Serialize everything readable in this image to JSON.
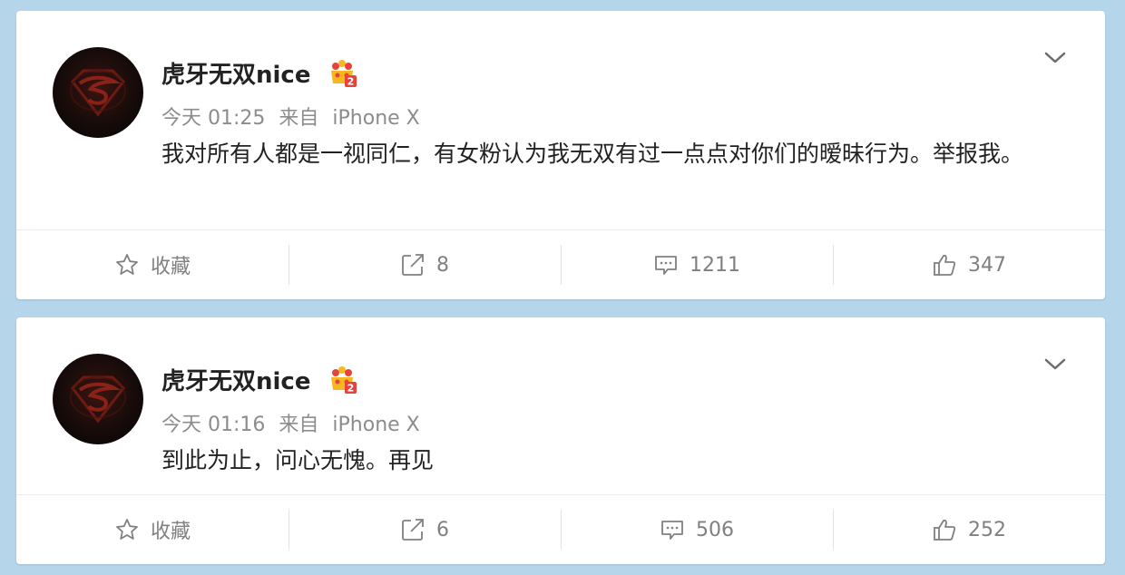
{
  "posts": [
    {
      "username": "虎牙无双nice",
      "time": "今天 01:25",
      "source_prefix": "来自",
      "source_device": "iPhone X",
      "content": "我对所有人都是一视同仁，有女粉认为我无双有过一点点对你们的暧昧行为。举报我。",
      "actions": {
        "favorite_label": "收藏",
        "repost_count": "8",
        "comment_count": "1211",
        "like_count": "347"
      }
    },
    {
      "username": "虎牙无双nice",
      "time": "今天 01:16",
      "source_prefix": "来自",
      "source_device": "iPhone X",
      "content": "到此为止，问心无愧。再见",
      "actions": {
        "favorite_label": "收藏",
        "repost_count": "6",
        "comment_count": "506",
        "like_count": "252"
      }
    }
  ],
  "icons": {
    "chevron": "chevron-down-icon",
    "favorite": "star-icon",
    "repost": "share-icon",
    "comment": "comment-icon",
    "like": "thumbs-up-icon",
    "badge": "vip-crown-icon"
  },
  "colors": {
    "page_background": "#b5d5ea",
    "card_background": "#ffffff",
    "username_text": "#222222",
    "meta_text": "#8c8c8c",
    "action_text": "#808080",
    "badge_gold": "#f5b820",
    "badge_red": "#e8433a"
  }
}
